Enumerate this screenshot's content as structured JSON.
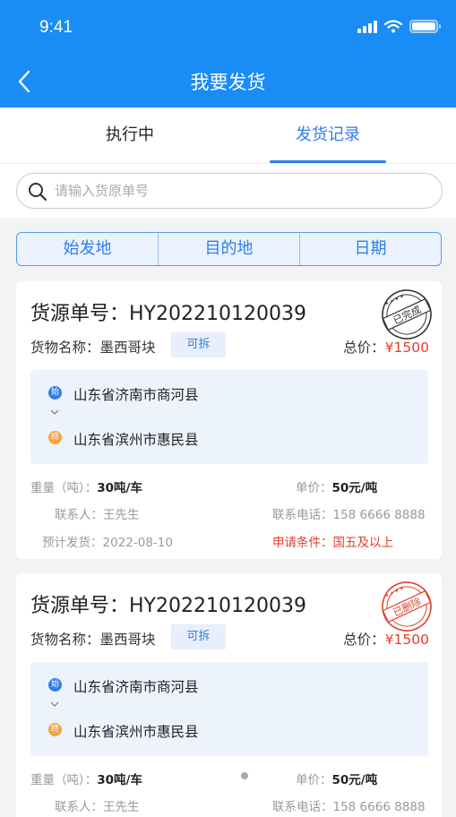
{
  "status_bar": {
    "time": "9:41"
  },
  "nav": {
    "title": "我要发货"
  },
  "tabs": [
    {
      "label": "执行中",
      "active": false
    },
    {
      "label": "发货记录",
      "active": true
    }
  ],
  "search": {
    "placeholder": "请输入货原单号",
    "value": ""
  },
  "filters": [
    "始发地",
    "目的地",
    "日期"
  ],
  "cards": [
    {
      "ship_no_label": "货源单号：",
      "ship_no": "HY202210120039",
      "goods_label": "货物名称：",
      "goods_name": "墨西哥块",
      "tag": "可拆",
      "total_label": "总价：",
      "total": "¥1500",
      "start_badge": "始",
      "end_badge": "终",
      "origin": "山东省济南市商河县",
      "destination": "山东省滨州市惠民县",
      "weight_label": "重量（吨）：",
      "weight": "30吨/车",
      "unit_price_label": "单价：",
      "unit_price": "50元/吨",
      "contact_label": "联系人：",
      "contact": "王先生",
      "phone_label": "联系电话：",
      "phone": "158 6666 8888",
      "date_label": "预计发货：",
      "date": "2022-08-10",
      "condition_label": "申请条件：",
      "condition": "国五及以上",
      "stamp": "已完成",
      "stamp_color": "#333333"
    },
    {
      "ship_no_label": "货源单号：",
      "ship_no": "HY202210120039",
      "goods_label": "货物名称：",
      "goods_name": "墨西哥块",
      "tag": "可拆",
      "total_label": "总价：",
      "total": "¥1500",
      "start_badge": "始",
      "end_badge": "终",
      "origin": "山东省济南市商河县",
      "destination": "山东省滨州市惠民县",
      "weight_label": "重量（吨）：",
      "weight": "30吨/车",
      "unit_price_label": "单价：",
      "unit_price": "50元/吨",
      "contact_label": "联系人：",
      "contact": "王先生",
      "phone_label": "联系电话：",
      "phone": "158 6666 8888",
      "stamp": "已删除",
      "stamp_color": "#e03f2e"
    }
  ],
  "colors": {
    "primary": "#1a8cf5",
    "accent": "#2f7ee8",
    "danger": "#e03f2e",
    "end_marker": "#f5a341"
  }
}
